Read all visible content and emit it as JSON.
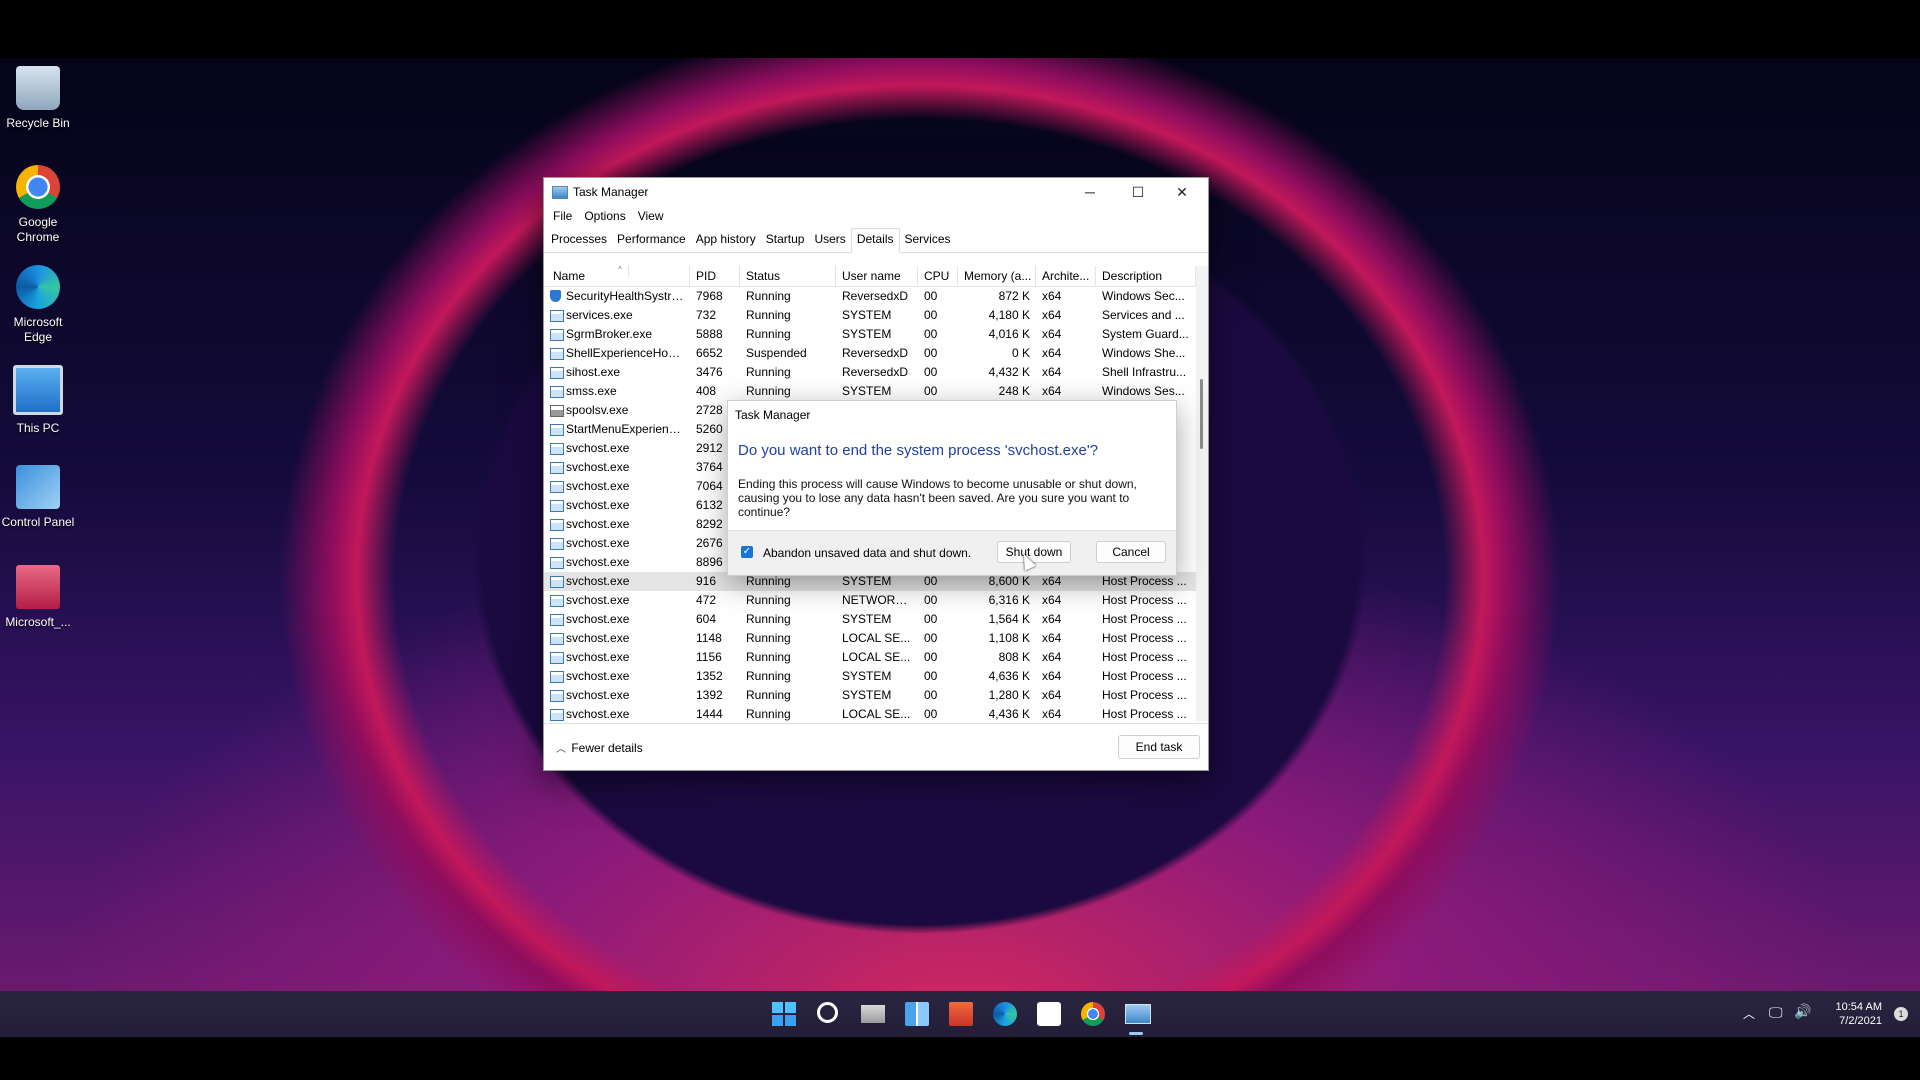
{
  "desktop_icons": [
    {
      "name": "recycle-bin",
      "label": "Recycle Bin",
      "icon": "recycle-bin-icon"
    },
    {
      "name": "google-chrome",
      "label": "Google Chrome",
      "icon": "chrome-icon"
    },
    {
      "name": "microsoft-edge",
      "label": "Microsoft Edge",
      "icon": "edge-icon"
    },
    {
      "name": "this-pc",
      "label": "This PC",
      "icon": "computer-icon"
    },
    {
      "name": "control-panel",
      "label": "Control Panel",
      "icon": "control-panel-icon"
    },
    {
      "name": "microsoft-shortcut",
      "label": "Microsoft_...",
      "icon": "package-icon"
    }
  ],
  "window": {
    "title": "Task Manager",
    "menu": [
      "File",
      "Options",
      "View"
    ],
    "tabs": [
      "Processes",
      "Performance",
      "App history",
      "Startup",
      "Users",
      "Details",
      "Services"
    ],
    "active_tab": "Details",
    "columns": [
      "Name",
      "PID",
      "Status",
      "User name",
      "CPU",
      "Memory (a...",
      "Archite...",
      "Description"
    ],
    "rows": [
      {
        "name": "SecurityHealthSystra...",
        "pid": "7968",
        "status": "Running",
        "user": "ReversedxD",
        "cpu": "00",
        "mem": "872 K",
        "arch": "x64",
        "desc": "Windows Sec...",
        "icon": "shield"
      },
      {
        "name": "services.exe",
        "pid": "732",
        "status": "Running",
        "user": "SYSTEM",
        "cpu": "00",
        "mem": "4,180 K",
        "arch": "x64",
        "desc": "Services and ...",
        "icon": "app"
      },
      {
        "name": "SgrmBroker.exe",
        "pid": "5888",
        "status": "Running",
        "user": "SYSTEM",
        "cpu": "00",
        "mem": "4,016 K",
        "arch": "x64",
        "desc": "System Guard...",
        "icon": "app"
      },
      {
        "name": "ShellExperienceHost....",
        "pid": "6652",
        "status": "Suspended",
        "user": "ReversedxD",
        "cpu": "00",
        "mem": "0 K",
        "arch": "x64",
        "desc": "Windows She...",
        "icon": "app"
      },
      {
        "name": "sihost.exe",
        "pid": "3476",
        "status": "Running",
        "user": "ReversedxD",
        "cpu": "00",
        "mem": "4,432 K",
        "arch": "x64",
        "desc": "Shell Infrastru...",
        "icon": "app"
      },
      {
        "name": "smss.exe",
        "pid": "408",
        "status": "Running",
        "user": "SYSTEM",
        "cpu": "00",
        "mem": "248 K",
        "arch": "x64",
        "desc": "Windows Ses...",
        "icon": "app"
      },
      {
        "name": "spoolsv.exe",
        "pid": "2728",
        "status": "",
        "user": "",
        "cpu": "",
        "mem": "",
        "arch": "",
        "desc": "",
        "icon": "printer"
      },
      {
        "name": "StartMenuExperienc...",
        "pid": "5260",
        "status": "",
        "user": "",
        "cpu": "",
        "mem": "",
        "arch": "",
        "desc": "",
        "icon": "app"
      },
      {
        "name": "svchost.exe",
        "pid": "2912",
        "status": "",
        "user": "",
        "cpu": "",
        "mem": "",
        "arch": "",
        "desc": "",
        "icon": "app"
      },
      {
        "name": "svchost.exe",
        "pid": "3764",
        "status": "",
        "user": "",
        "cpu": "",
        "mem": "",
        "arch": "",
        "desc": "",
        "icon": "app"
      },
      {
        "name": "svchost.exe",
        "pid": "7064",
        "status": "",
        "user": "",
        "cpu": "",
        "mem": "",
        "arch": "",
        "desc": "",
        "icon": "app"
      },
      {
        "name": "svchost.exe",
        "pid": "6132",
        "status": "",
        "user": "",
        "cpu": "",
        "mem": "",
        "arch": "",
        "desc": "",
        "icon": "app"
      },
      {
        "name": "svchost.exe",
        "pid": "8292",
        "status": "",
        "user": "",
        "cpu": "",
        "mem": "",
        "arch": "",
        "desc": "",
        "icon": "app"
      },
      {
        "name": "svchost.exe",
        "pid": "2676",
        "status": "",
        "user": "",
        "cpu": "",
        "mem": "",
        "arch": "",
        "desc": "",
        "icon": "app"
      },
      {
        "name": "svchost.exe",
        "pid": "8896",
        "status": "",
        "user": "",
        "cpu": "",
        "mem": "",
        "arch": "",
        "desc": "",
        "icon": "app"
      },
      {
        "name": "svchost.exe",
        "pid": "916",
        "status": "Running",
        "user": "SYSTEM",
        "cpu": "00",
        "mem": "8,600 K",
        "arch": "x64",
        "desc": "Host Process ...",
        "icon": "app",
        "selected": true
      },
      {
        "name": "svchost.exe",
        "pid": "472",
        "status": "Running",
        "user": "NETWORK...",
        "cpu": "00",
        "mem": "6,316 K",
        "arch": "x64",
        "desc": "Host Process ...",
        "icon": "app"
      },
      {
        "name": "svchost.exe",
        "pid": "604",
        "status": "Running",
        "user": "SYSTEM",
        "cpu": "00",
        "mem": "1,564 K",
        "arch": "x64",
        "desc": "Host Process ...",
        "icon": "app"
      },
      {
        "name": "svchost.exe",
        "pid": "1148",
        "status": "Running",
        "user": "LOCAL SE...",
        "cpu": "00",
        "mem": "1,108 K",
        "arch": "x64",
        "desc": "Host Process ...",
        "icon": "app"
      },
      {
        "name": "svchost.exe",
        "pid": "1156",
        "status": "Running",
        "user": "LOCAL SE...",
        "cpu": "00",
        "mem": "808 K",
        "arch": "x64",
        "desc": "Host Process ...",
        "icon": "app"
      },
      {
        "name": "svchost.exe",
        "pid": "1352",
        "status": "Running",
        "user": "SYSTEM",
        "cpu": "00",
        "mem": "4,636 K",
        "arch": "x64",
        "desc": "Host Process ...",
        "icon": "app"
      },
      {
        "name": "svchost.exe",
        "pid": "1392",
        "status": "Running",
        "user": "SYSTEM",
        "cpu": "00",
        "mem": "1,280 K",
        "arch": "x64",
        "desc": "Host Process ...",
        "icon": "app"
      },
      {
        "name": "svchost.exe",
        "pid": "1444",
        "status": "Running",
        "user": "LOCAL SE...",
        "cpu": "00",
        "mem": "4,436 K",
        "arch": "x64",
        "desc": "Host Process ...",
        "icon": "app"
      }
    ],
    "fewer_details": "Fewer details",
    "end_task": "End task"
  },
  "dialog": {
    "title": "Task Manager",
    "heading": "Do you want to end the system process 'svchost.exe'?",
    "body": "Ending this process will cause Windows to become unusable or shut down, causing you to lose any data hasn't been saved. Are you sure you want to continue?",
    "checkbox_label": "Abandon unsaved data and shut down.",
    "checkbox_checked": true,
    "primary_button": "Shut down",
    "cancel_button": "Cancel"
  },
  "taskbar": {
    "apps": [
      "start-icon",
      "search-icon",
      "task-view-icon",
      "widgets-icon",
      "file-explorer-icon",
      "edge-icon",
      "store-icon",
      "chrome-icon",
      "task-manager-icon"
    ],
    "time": "10:54 AM",
    "date": "7/2/2021",
    "notification_count": "1"
  }
}
